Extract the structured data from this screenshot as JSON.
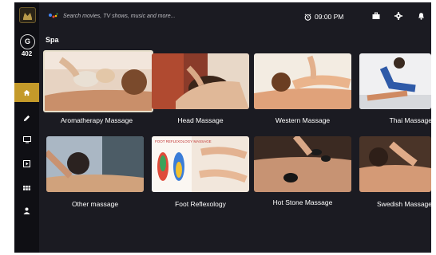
{
  "search": {
    "placeholder": "Search movies, TV shows, music and more..."
  },
  "status": {
    "time": "09:00 PM",
    "cut_digit": "1"
  },
  "user": {
    "initial": "G",
    "room": "402"
  },
  "section": {
    "title": "Spa"
  },
  "tiles": [
    {
      "title": "Aromatherapy Massage"
    },
    {
      "title": "Head Massage"
    },
    {
      "title": "Western Massage"
    },
    {
      "title": "Thai Massage"
    },
    {
      "title": "Other massage"
    },
    {
      "title": "Foot Reflexology",
      "poster_text": "FOOT REFLEXOLOGY MASSAGE"
    },
    {
      "title": "Hot Stone Massage"
    },
    {
      "title": "Swedish Massage"
    }
  ],
  "sidebar": {
    "items": [
      "home-icon",
      "pencil-icon",
      "tv-icon",
      "play-icon",
      "apps-icon",
      "person-icon"
    ]
  },
  "colors": {
    "accent": "#c49a2a",
    "background": "#1b1b22"
  }
}
